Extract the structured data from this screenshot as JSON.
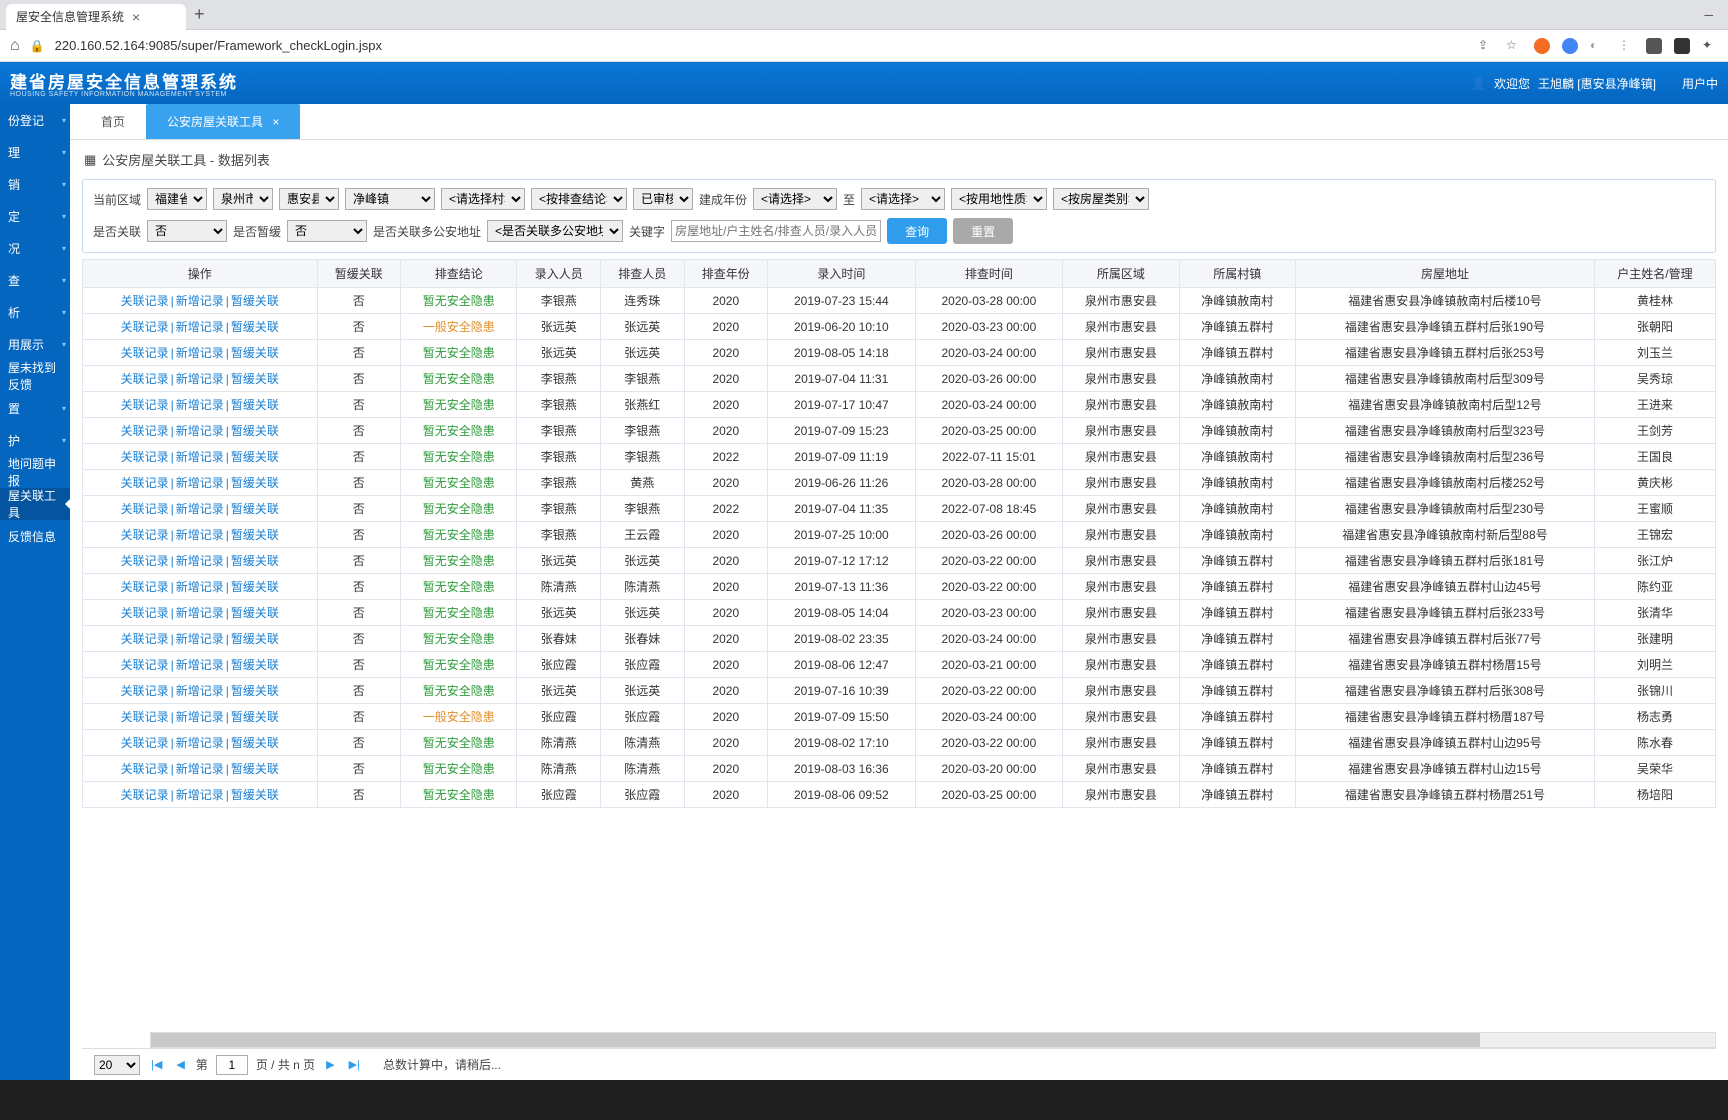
{
  "browser": {
    "tab_title": "屋安全信息管理系统",
    "url": "220.160.52.164:9085/super/Framework_checkLogin.jspx"
  },
  "header": {
    "logo": "建省房屋安全信息管理系统",
    "logo_sub": "HOUSING SAFETY INFORMATION MANAGEMENT SYSTEM",
    "welcome": "欢迎您",
    "user": "王旭麟 [惠安县净峰镇]",
    "user_center": "用户中"
  },
  "sidebar": {
    "items": [
      {
        "label": "份登记"
      },
      {
        "label": "理"
      },
      {
        "label": "销"
      },
      {
        "label": "定"
      },
      {
        "label": "况"
      },
      {
        "label": "查"
      },
      {
        "label": "析"
      },
      {
        "label": "用展示"
      },
      {
        "label": "屋未找到反馈"
      },
      {
        "label": "置"
      },
      {
        "label": "护"
      },
      {
        "label": "地问题申报"
      },
      {
        "label": "屋关联工具"
      },
      {
        "label": "反馈信息"
      }
    ]
  },
  "tabs": {
    "home": "首页",
    "active": "公安房屋关联工具"
  },
  "crumb": "公安房屋关联工具 - 数据列表",
  "filters": {
    "region_label": "当前区域",
    "province": "福建省",
    "city": "泉州市",
    "county": "惠安县",
    "town": "净峰镇",
    "village": "<请选择村>",
    "conclusion": "<按排查结论>",
    "audited": "已审核",
    "build_year_label": "建成年份",
    "year_from": "<请选择>",
    "to": "至",
    "year_to": "<请选择>",
    "land_type": "<按用地性质>",
    "house_type": "<按房屋类别>",
    "is_linked_label": "是否关联",
    "is_linked": "否",
    "is_temp_label": "是否暂缓",
    "is_temp": "否",
    "multi_addr_label": "是否关联多公安地址",
    "multi_addr": "<是否关联多公安地址>",
    "keyword_label": "关键字",
    "keyword_placeholder": "房屋地址/户主姓名/排查人员/录入人员",
    "search": "查询",
    "reset": "重置"
  },
  "columns": [
    "操作",
    "暂缓关联",
    "排查结论",
    "录入人员",
    "排查人员",
    "排查年份",
    "录入时间",
    "排查时间",
    "所属区域",
    "所属村镇",
    "房屋地址",
    "户主姓名/管理"
  ],
  "actions": {
    "link": "关联记录",
    "add": "新增记录",
    "pause": "暂缓关联"
  },
  "rows": [
    {
      "pause": "否",
      "cc": "暂无安全隐患",
      "cc_cls": "green",
      "in": "李银燕",
      "chk": "连秀珠",
      "yr": "2020",
      "intime": "2019-07-23 15:44",
      "chktime": "2020-03-28 00:00",
      "area": "泉州市惠安县",
      "vill": "净峰镇赦南村",
      "addr": "福建省惠安县净峰镇赦南村后楼10号",
      "owner": "黄桂林"
    },
    {
      "pause": "否",
      "cc": "一般安全隐患",
      "cc_cls": "orange",
      "in": "张远英",
      "chk": "张远英",
      "yr": "2020",
      "intime": "2019-06-20 10:10",
      "chktime": "2020-03-23 00:00",
      "area": "泉州市惠安县",
      "vill": "净峰镇五群村",
      "addr": "福建省惠安县净峰镇五群村后张190号",
      "owner": "张朝阳"
    },
    {
      "pause": "否",
      "cc": "暂无安全隐患",
      "cc_cls": "green",
      "in": "张远英",
      "chk": "张远英",
      "yr": "2020",
      "intime": "2019-08-05 14:18",
      "chktime": "2020-03-24 00:00",
      "area": "泉州市惠安县",
      "vill": "净峰镇五群村",
      "addr": "福建省惠安县净峰镇五群村后张253号",
      "owner": "刘玉兰"
    },
    {
      "pause": "否",
      "cc": "暂无安全隐患",
      "cc_cls": "green",
      "in": "李银燕",
      "chk": "李银燕",
      "yr": "2020",
      "intime": "2019-07-04 11:31",
      "chktime": "2020-03-26 00:00",
      "area": "泉州市惠安县",
      "vill": "净峰镇赦南村",
      "addr": "福建省惠安县净峰镇赦南村后型309号",
      "owner": "吴秀琼"
    },
    {
      "pause": "否",
      "cc": "暂无安全隐患",
      "cc_cls": "green",
      "in": "李银燕",
      "chk": "张燕红",
      "yr": "2020",
      "intime": "2019-07-17 10:47",
      "chktime": "2020-03-24 00:00",
      "area": "泉州市惠安县",
      "vill": "净峰镇赦南村",
      "addr": "福建省惠安县净峰镇赦南村后型12号",
      "owner": "王进来"
    },
    {
      "pause": "否",
      "cc": "暂无安全隐患",
      "cc_cls": "green",
      "in": "李银燕",
      "chk": "李银燕",
      "yr": "2020",
      "intime": "2019-07-09 15:23",
      "chktime": "2020-03-25 00:00",
      "area": "泉州市惠安县",
      "vill": "净峰镇赦南村",
      "addr": "福建省惠安县净峰镇赦南村后型323号",
      "owner": "王剑芳"
    },
    {
      "pause": "否",
      "cc": "暂无安全隐患",
      "cc_cls": "green",
      "in": "李银燕",
      "chk": "李银燕",
      "yr": "2022",
      "intime": "2019-07-09 11:19",
      "chktime": "2022-07-11 15:01",
      "area": "泉州市惠安县",
      "vill": "净峰镇赦南村",
      "addr": "福建省惠安县净峰镇赦南村后型236号",
      "owner": "王国良"
    },
    {
      "pause": "否",
      "cc": "暂无安全隐患",
      "cc_cls": "green",
      "in": "李银燕",
      "chk": "黄燕",
      "yr": "2020",
      "intime": "2019-06-26 11:26",
      "chktime": "2020-03-28 00:00",
      "area": "泉州市惠安县",
      "vill": "净峰镇赦南村",
      "addr": "福建省惠安县净峰镇赦南村后楼252号",
      "owner": "黄庆彬"
    },
    {
      "pause": "否",
      "cc": "暂无安全隐患",
      "cc_cls": "green",
      "in": "李银燕",
      "chk": "李银燕",
      "yr": "2022",
      "intime": "2019-07-04 11:35",
      "chktime": "2022-07-08 18:45",
      "area": "泉州市惠安县",
      "vill": "净峰镇赦南村",
      "addr": "福建省惠安县净峰镇赦南村后型230号",
      "owner": "王蜜顺"
    },
    {
      "pause": "否",
      "cc": "暂无安全隐患",
      "cc_cls": "green",
      "in": "李银燕",
      "chk": "王云霞",
      "yr": "2020",
      "intime": "2019-07-25 10:00",
      "chktime": "2020-03-26 00:00",
      "area": "泉州市惠安县",
      "vill": "净峰镇赦南村",
      "addr": "福建省惠安县净峰镇赦南村新后型88号",
      "owner": "王锦宏"
    },
    {
      "pause": "否",
      "cc": "暂无安全隐患",
      "cc_cls": "green",
      "in": "张远英",
      "chk": "张远英",
      "yr": "2020",
      "intime": "2019-07-12 17:12",
      "chktime": "2020-03-22 00:00",
      "area": "泉州市惠安县",
      "vill": "净峰镇五群村",
      "addr": "福建省惠安县净峰镇五群村后张181号",
      "owner": "张江炉"
    },
    {
      "pause": "否",
      "cc": "暂无安全隐患",
      "cc_cls": "green",
      "in": "陈清燕",
      "chk": "陈清燕",
      "yr": "2020",
      "intime": "2019-07-13 11:36",
      "chktime": "2020-03-22 00:00",
      "area": "泉州市惠安县",
      "vill": "净峰镇五群村",
      "addr": "福建省惠安县净峰镇五群村山边45号",
      "owner": "陈约亚"
    },
    {
      "pause": "否",
      "cc": "暂无安全隐患",
      "cc_cls": "green",
      "in": "张远英",
      "chk": "张远英",
      "yr": "2020",
      "intime": "2019-08-05 14:04",
      "chktime": "2020-03-23 00:00",
      "area": "泉州市惠安县",
      "vill": "净峰镇五群村",
      "addr": "福建省惠安县净峰镇五群村后张233号",
      "owner": "张清华"
    },
    {
      "pause": "否",
      "cc": "暂无安全隐患",
      "cc_cls": "green",
      "in": "张春妹",
      "chk": "张春妹",
      "yr": "2020",
      "intime": "2019-08-02 23:35",
      "chktime": "2020-03-24 00:00",
      "area": "泉州市惠安县",
      "vill": "净峰镇五群村",
      "addr": "福建省惠安县净峰镇五群村后张77号",
      "owner": "张建明"
    },
    {
      "pause": "否",
      "cc": "暂无安全隐患",
      "cc_cls": "green",
      "in": "张应霞",
      "chk": "张应霞",
      "yr": "2020",
      "intime": "2019-08-06 12:47",
      "chktime": "2020-03-21 00:00",
      "area": "泉州市惠安县",
      "vill": "净峰镇五群村",
      "addr": "福建省惠安县净峰镇五群村杨厝15号",
      "owner": "刘明兰"
    },
    {
      "pause": "否",
      "cc": "暂无安全隐患",
      "cc_cls": "green",
      "in": "张远英",
      "chk": "张远英",
      "yr": "2020",
      "intime": "2019-07-16 10:39",
      "chktime": "2020-03-22 00:00",
      "area": "泉州市惠安县",
      "vill": "净峰镇五群村",
      "addr": "福建省惠安县净峰镇五群村后张308号",
      "owner": "张锦川"
    },
    {
      "pause": "否",
      "cc": "一般安全隐患",
      "cc_cls": "orange",
      "in": "张应霞",
      "chk": "张应霞",
      "yr": "2020",
      "intime": "2019-07-09 15:50",
      "chktime": "2020-03-24 00:00",
      "area": "泉州市惠安县",
      "vill": "净峰镇五群村",
      "addr": "福建省惠安县净峰镇五群村杨厝187号",
      "owner": "杨志勇"
    },
    {
      "pause": "否",
      "cc": "暂无安全隐患",
      "cc_cls": "green",
      "in": "陈清燕",
      "chk": "陈清燕",
      "yr": "2020",
      "intime": "2019-08-02 17:10",
      "chktime": "2020-03-22 00:00",
      "area": "泉州市惠安县",
      "vill": "净峰镇五群村",
      "addr": "福建省惠安县净峰镇五群村山边95号",
      "owner": "陈水春"
    },
    {
      "pause": "否",
      "cc": "暂无安全隐患",
      "cc_cls": "green",
      "in": "陈清燕",
      "chk": "陈清燕",
      "yr": "2020",
      "intime": "2019-08-03 16:36",
      "chktime": "2020-03-20 00:00",
      "area": "泉州市惠安县",
      "vill": "净峰镇五群村",
      "addr": "福建省惠安县净峰镇五群村山边15号",
      "owner": "吴荣华"
    },
    {
      "pause": "否",
      "cc": "暂无安全隐患",
      "cc_cls": "green",
      "in": "张应霞",
      "chk": "张应霞",
      "yr": "2020",
      "intime": "2019-08-06 09:52",
      "chktime": "2020-03-25 00:00",
      "area": "泉州市惠安县",
      "vill": "净峰镇五群村",
      "addr": "福建省惠安县净峰镇五群村杨厝251号",
      "owner": "杨培阳"
    }
  ],
  "pager": {
    "pagesize": "20",
    "page_label_pre": "第",
    "page": "1",
    "page_label_post": "页 / 共 n 页",
    "status": "总数计算中，请稍后..."
  }
}
